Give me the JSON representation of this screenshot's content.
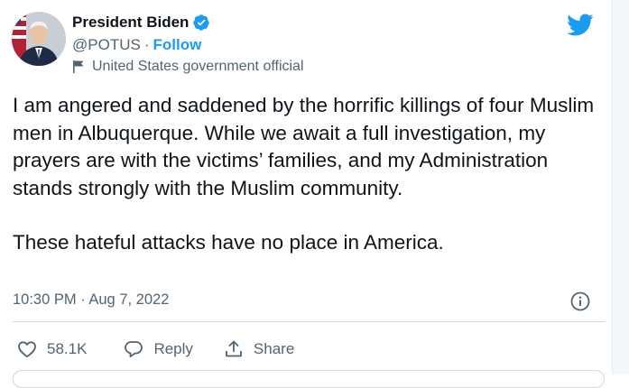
{
  "author": {
    "display_name": "President Biden",
    "handle": "@POTUS",
    "separator": "·",
    "follow_label": "Follow",
    "account_label": "United States government official"
  },
  "tweet": {
    "paragraph1": "I am angered and saddened by the horrific killings of four Muslim men in Albuquerque. While we await a full investigation, my prayers are with the victims’ families, and my Administration stands strongly with the Muslim community.",
    "paragraph2": "These hateful attacks have no place in America.",
    "timestamp": "10:30 PM · Aug 7, 2022"
  },
  "actions": {
    "like_count": "58.1K",
    "reply_label": "Reply",
    "share_label": "Share"
  },
  "icons": {
    "verified": "verified-badge-icon",
    "platform": "twitter-bird-icon",
    "label": "flag-icon",
    "info": "info-icon",
    "like": "heart-icon",
    "reply": "reply-bubble-icon",
    "share": "share-icon"
  },
  "colors": {
    "accent": "#1d9bf0",
    "text_primary": "#0f1419",
    "text_secondary": "#536471",
    "divider": "#cfd9de"
  }
}
